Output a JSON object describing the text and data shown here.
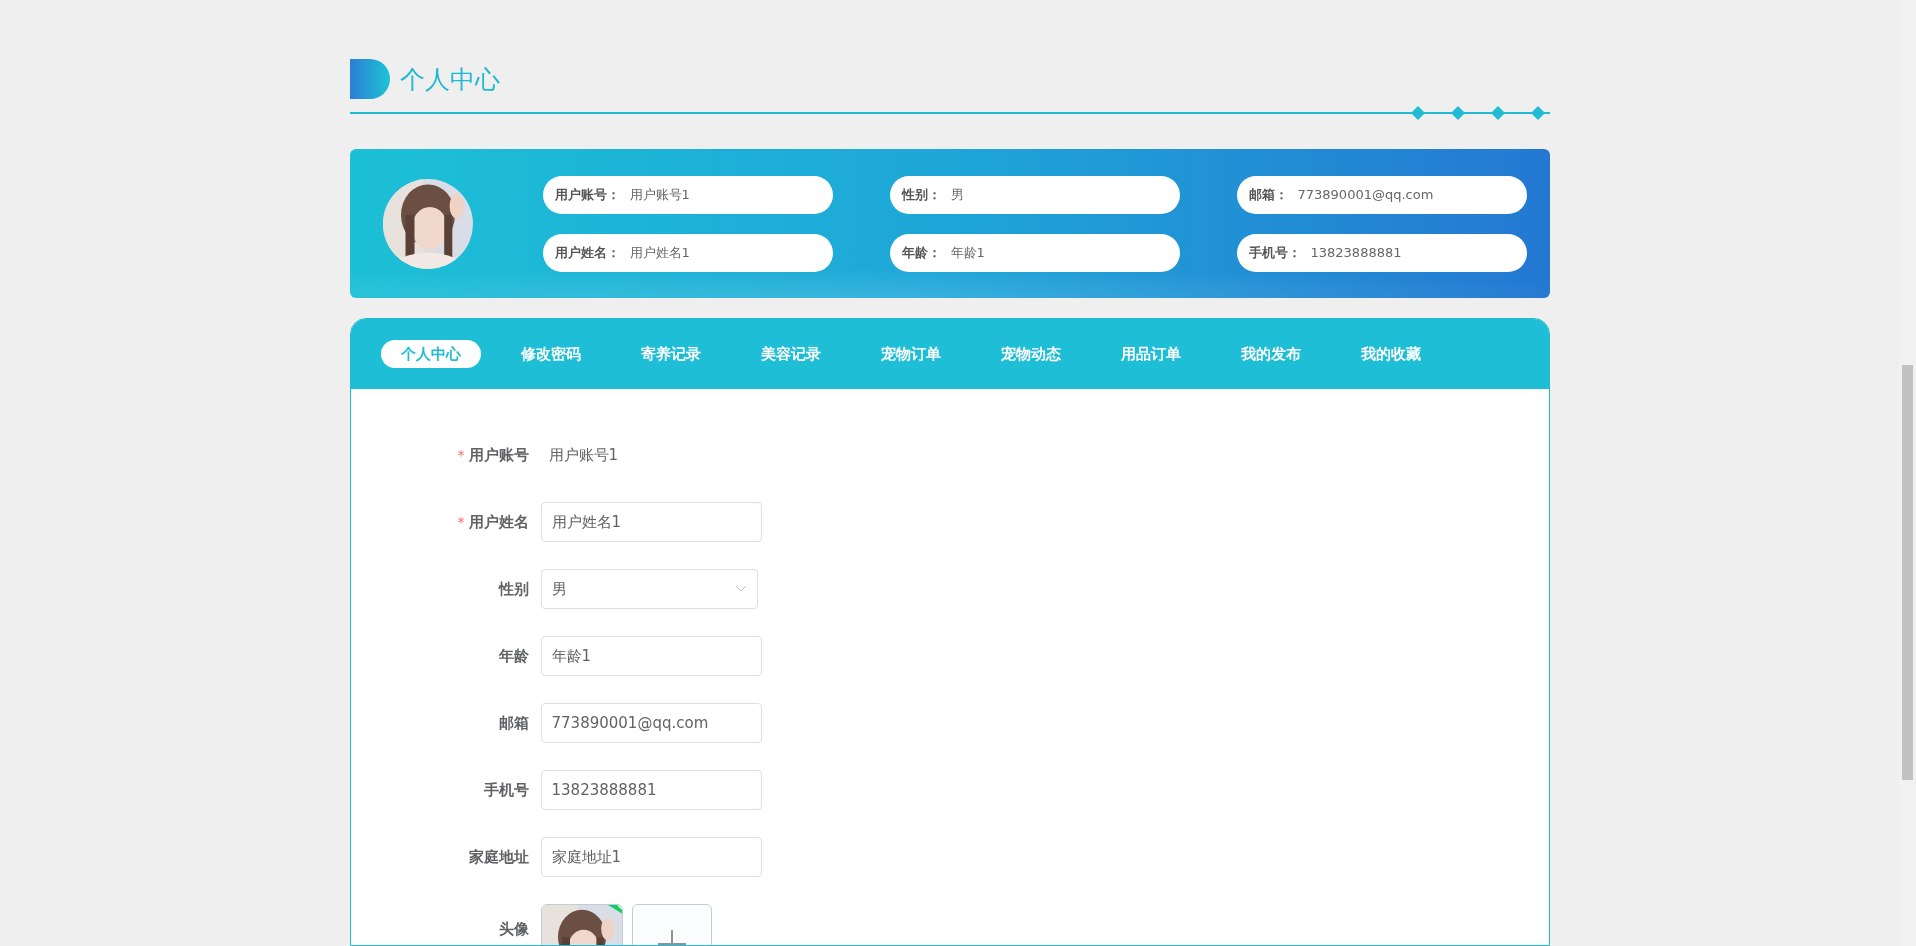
{
  "page_title": "个人中心",
  "profile_card": {
    "fields": [
      {
        "label": "用户账号：",
        "value": "用户账号1"
      },
      {
        "label": "性别：",
        "value": "男"
      },
      {
        "label": "邮箱：",
        "value": "773890001@qq.com"
      },
      {
        "label": "用户姓名：",
        "value": "用户姓名1"
      },
      {
        "label": "年龄：",
        "value": "年龄1"
      },
      {
        "label": "手机号：",
        "value": "13823888881"
      }
    ]
  },
  "tabs": [
    {
      "label": "个人中心",
      "selected": true
    },
    {
      "label": "修改密码",
      "selected": false
    },
    {
      "label": "寄养记录",
      "selected": false
    },
    {
      "label": "美容记录",
      "selected": false
    },
    {
      "label": "宠物订单",
      "selected": false
    },
    {
      "label": "宠物动态",
      "selected": false
    },
    {
      "label": "用品订单",
      "selected": false
    },
    {
      "label": "我的发布",
      "selected": false
    },
    {
      "label": "我的收藏",
      "selected": false
    }
  ],
  "form": [
    {
      "kind": "text",
      "marker": "*",
      "label": "用户账号",
      "value": "用户账号1"
    },
    {
      "kind": "input",
      "marker": "*",
      "label": "用户姓名",
      "value": "用户姓名1"
    },
    {
      "kind": "select",
      "label": "性别",
      "value": "男"
    },
    {
      "kind": "input",
      "label": "年龄",
      "value": "年龄1"
    },
    {
      "kind": "input",
      "label": "邮箱",
      "value": "773890001@qq.com"
    },
    {
      "kind": "input",
      "label": "手机号",
      "value": "13823888881"
    },
    {
      "kind": "input",
      "label": "家庭地址",
      "value": "家庭地址1"
    },
    {
      "kind": "upload",
      "label": "头像"
    }
  ]
}
